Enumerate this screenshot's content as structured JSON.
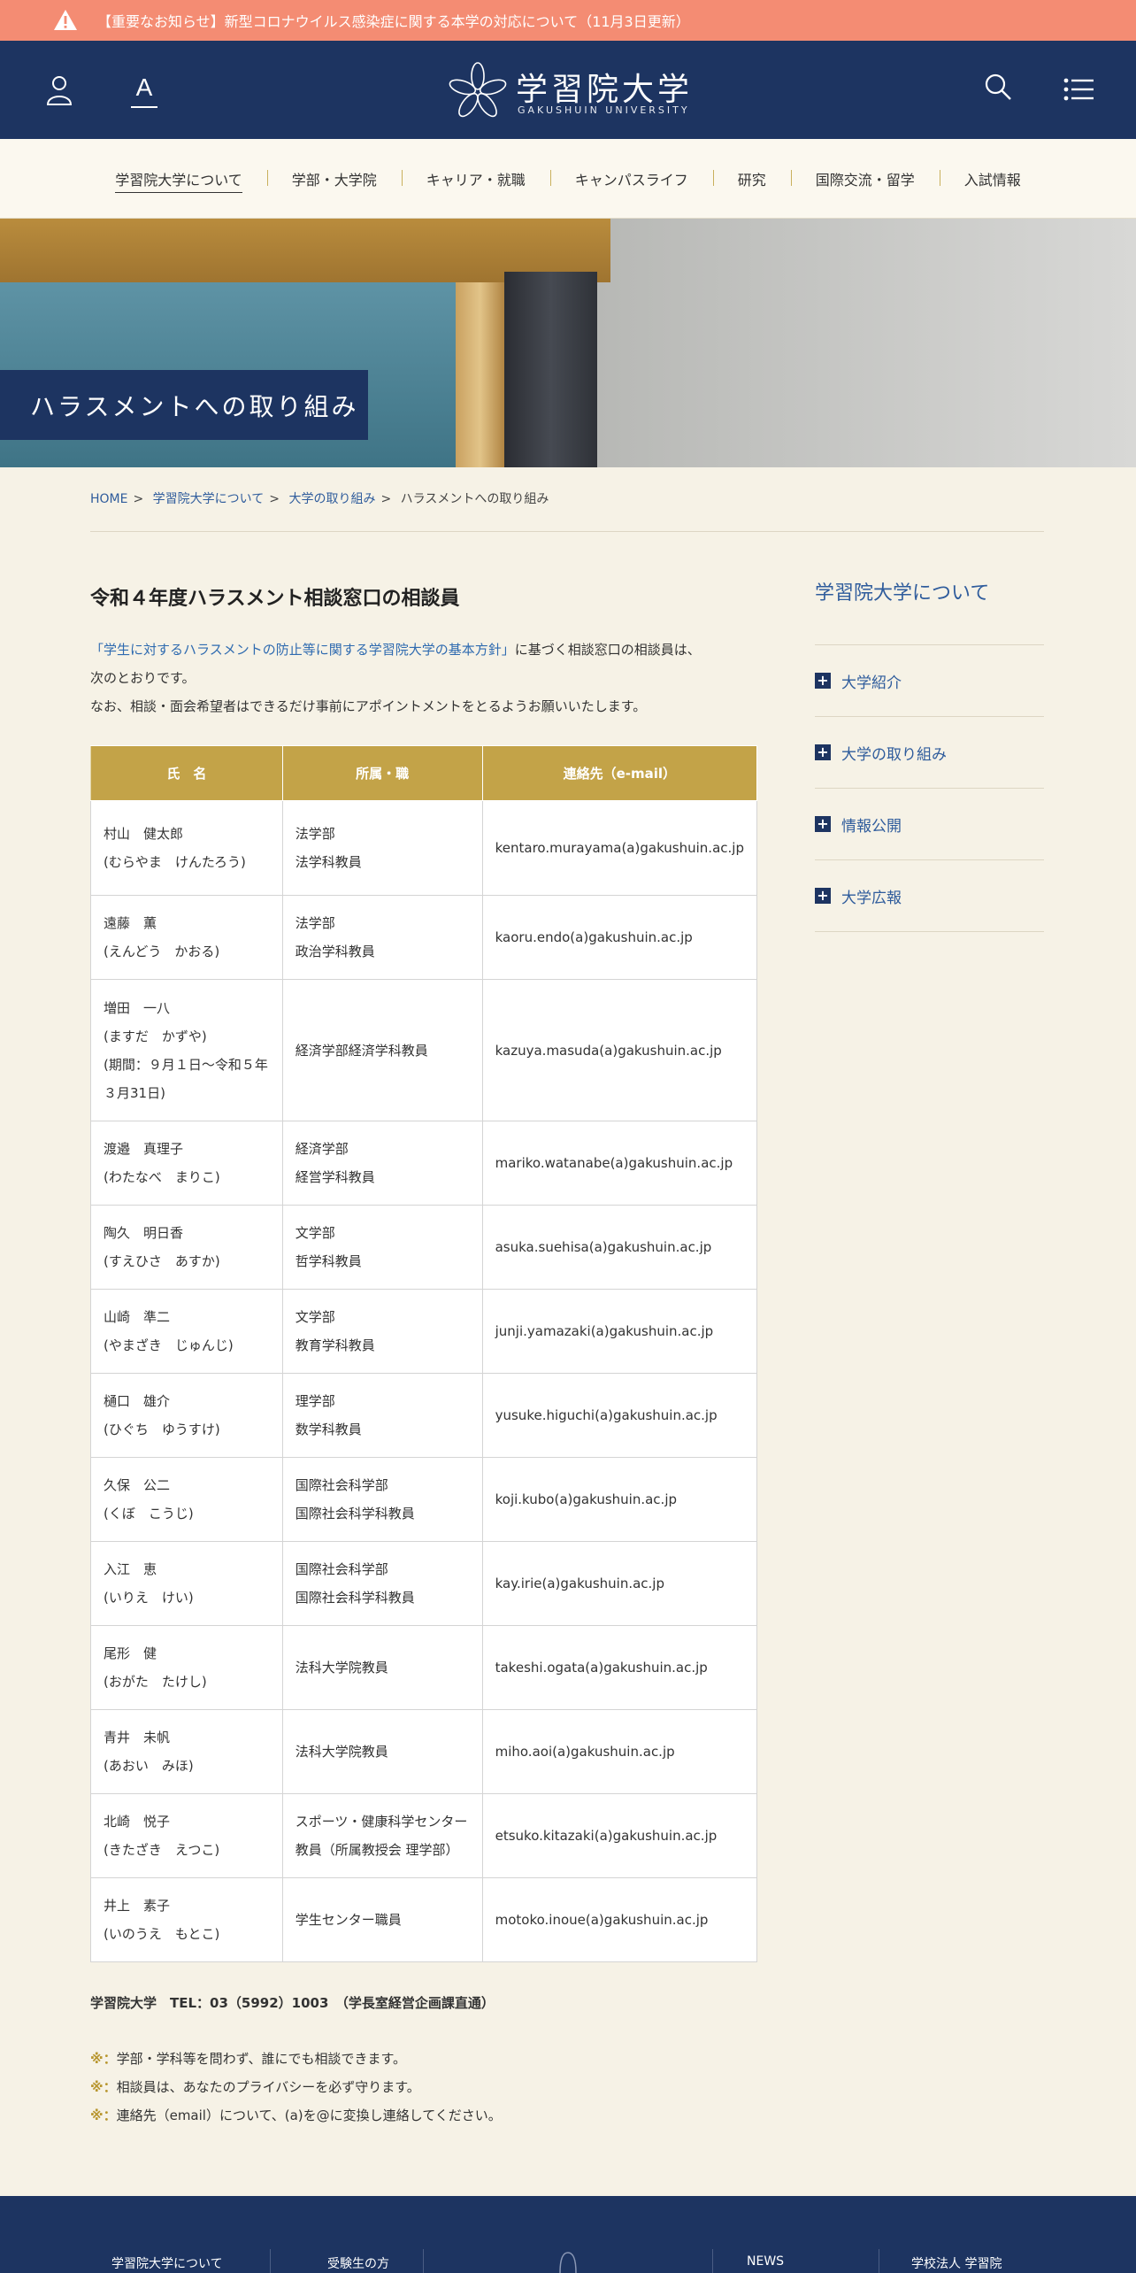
{
  "alert": {
    "icon": "warning-icon",
    "text": "【重要なお知らせ】新型コロナウイルス感染症に関する本学の対応について（11月3日更新）"
  },
  "header": {
    "icons": [
      "user-icon",
      "font-size-icon",
      "search-icon",
      "menu-list-icon"
    ],
    "font_label": "A",
    "logo_jp": "学習院大学",
    "logo_en": "GAKUSHUIN UNIVERSITY"
  },
  "gnav": [
    "学習院大学について",
    "学部・大学院",
    "キャリア・就職",
    "キャンパスライフ",
    "研究",
    "国際交流・留学",
    "入試情報"
  ],
  "hero_title": "ハラスメントへの取り組み",
  "breadcrumb": {
    "items": [
      "HOME",
      "学習院大学について",
      "大学の取り組み"
    ],
    "current": "ハラスメントへの取り組み"
  },
  "main": {
    "heading": "令和４年度ハラスメント相談窓口の相談員",
    "intro_link": "「学生に対するハラスメントの防止等に関する学習院大学の基本方針」",
    "intro_1": "に基づく相談窓口の相談員は、",
    "intro_2": "次のとおりです。",
    "intro_3": "なお、相談・面会希望者はできるだけ事前にアポイントメントをとるようお願いいたします。"
  },
  "table": {
    "headers": [
      "氏　名",
      "所属・職",
      "連絡先（e-mail）"
    ],
    "rows": [
      {
        "name": [
          "村山　健太郎",
          "(むらやま　けんたろう)"
        ],
        "dept": [
          "法学部",
          "法学科教員"
        ],
        "email_user": "kentaro.murayama",
        "email_domain": "gakushuin.ac.jp"
      },
      {
        "name": [
          "遠藤　薫",
          "(えんどう　かおる)"
        ],
        "dept": [
          "法学部",
          "政治学科教員"
        ],
        "email_user": "kaoru.endo",
        "email_domain": "gakushuin.ac.jp"
      },
      {
        "name": [
          "増田　一八",
          "(ますだ　かずや)",
          "(期間：９月１日～令和５年",
          "３月31日)"
        ],
        "dept": [
          "経済学部経済学科教員"
        ],
        "email_user": "kazuya.masuda",
        "email_domain": "gakushuin.ac.jp"
      },
      {
        "name": [
          "渡邉　真理子",
          "(わたなべ　まりこ)"
        ],
        "dept": [
          "経済学部",
          "経営学科教員"
        ],
        "email_user": "mariko.watanabe",
        "email_domain": "gakushuin.ac.jp"
      },
      {
        "name": [
          "陶久　明日香",
          "(すえひさ　あすか)"
        ],
        "dept": [
          "文学部",
          "哲学科教員"
        ],
        "email_user": "asuka.suehisa",
        "email_domain": "gakushuin.ac.jp"
      },
      {
        "name": [
          "山崎　準二",
          "(やまざき　じゅんじ)"
        ],
        "dept": [
          "文学部",
          "教育学科教員"
        ],
        "email_user": "junji.yamazaki",
        "email_domain": "gakushuin.ac.jp"
      },
      {
        "name": [
          "樋口　雄介",
          "(ひぐち　ゆうすけ)"
        ],
        "dept": [
          "理学部",
          "数学科教員"
        ],
        "email_user": "yusuke.higuchi",
        "email_domain": "gakushuin.ac.jp"
      },
      {
        "name": [
          "久保　公二",
          "(くぼ　こうじ)"
        ],
        "dept": [
          "国際社会科学部",
          "国際社会科学科教員"
        ],
        "email_user": "koji.kubo",
        "email_domain": "gakushuin.ac.jp"
      },
      {
        "name": [
          "入江　恵",
          "(いりえ　けい)"
        ],
        "dept": [
          "国際社会科学部",
          "国際社会科学科教員"
        ],
        "email_user": "kay.irie",
        "email_domain": "gakushuin.ac.jp"
      },
      {
        "name": [
          "尾形　健",
          "(おがた　たけし)"
        ],
        "dept": [
          "法科大学院教員"
        ],
        "email_user": "takeshi.ogata",
        "email_domain": "gakushuin.ac.jp"
      },
      {
        "name": [
          "青井　未帆",
          "(あおい　みほ)"
        ],
        "dept": [
          "法科大学院教員"
        ],
        "email_user": "miho.aoi",
        "email_domain": "gakushuin.ac.jp"
      },
      {
        "name": [
          "北崎　悦子",
          "(きたざき　えつこ)"
        ],
        "dept": [
          "スポーツ・健康科学センター",
          "教員（所属教授会 理学部）"
        ],
        "email_user": "etsuko.kitazaki",
        "email_domain": "gakushuin.ac.jp"
      },
      {
        "name": [
          "井上　素子",
          "(いのうえ　もとこ)"
        ],
        "dept": [
          "学生センター職員"
        ],
        "email_user": "motoko.inoue",
        "email_domain": "gakushuin.ac.jp"
      }
    ],
    "at_mark": "(a)"
  },
  "tel": "学習院大学　TEL：03（5992）1003　（学長室経営企画課直通）",
  "notes": [
    {
      "mark": "※：",
      "text": "学部・学科等を問わず、誰にでも相談できます。"
    },
    {
      "mark": "※：",
      "text": "相談員は、あなたのプライバシーを必ず守ります。"
    },
    {
      "mark": "※：",
      "text": "連絡先（email）について、(a)を@に変換し連絡してください。"
    }
  ],
  "sidebar": {
    "title": "学習院大学について",
    "items": [
      "大学紹介",
      "大学の取り組み",
      "情報公開",
      "大学広報"
    ]
  },
  "footer": [
    "学習院大学について",
    "受験生の方",
    "NEWS",
    "学校法人 学習院"
  ],
  "colors": {
    "navy": "#1d3461",
    "gold": "#c3a348",
    "alert": "#f48c73",
    "link": "#2f5c9c"
  }
}
